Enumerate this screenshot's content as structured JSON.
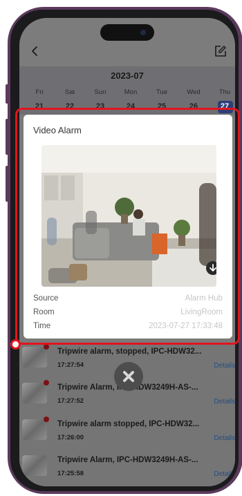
{
  "calendar": {
    "month": "2023-07",
    "days": [
      {
        "name": "Fri",
        "num": "21"
      },
      {
        "name": "Sat",
        "num": "22"
      },
      {
        "name": "Sun",
        "num": "23"
      },
      {
        "name": "Mon",
        "num": "24"
      },
      {
        "name": "Tue",
        "num": "25"
      },
      {
        "name": "Wed",
        "num": "26"
      },
      {
        "name": "Thu",
        "num": "27"
      }
    ]
  },
  "alarm_card": {
    "title": "Video Alarm",
    "source_label": "Source",
    "source_value": "Alarm Hub",
    "room_label": "Room",
    "room_value": "LivingRoom",
    "time_label": "Time",
    "time_value": "2023-07-27 17:33:48"
  },
  "events": [
    {
      "title": "Tripwire alarm, stopped, IPC-HDW32...",
      "time": "17:27:54",
      "details": "Details"
    },
    {
      "title": "Tripwire Alarm, IPC-HDW3249H-AS-...",
      "time": "17:27:52",
      "details": "Details"
    },
    {
      "title": "Tripwire alarm stopped, IPC-HDW32...",
      "time": "17:26:00",
      "details": "Details"
    },
    {
      "title": "Tripwire Alarm, IPC-HDW3249H-AS-...",
      "time": "17:25:58",
      "details": "Details"
    }
  ],
  "colors": {
    "phone_frame": "#5b3a5c",
    "highlight": "#e3141f",
    "selected_day": "#2c3f78",
    "details_link": "#1f4e8a"
  },
  "icons": {
    "back": "chevron-left-icon",
    "edit": "edit-icon",
    "download": "download-icon",
    "close": "close-icon"
  }
}
